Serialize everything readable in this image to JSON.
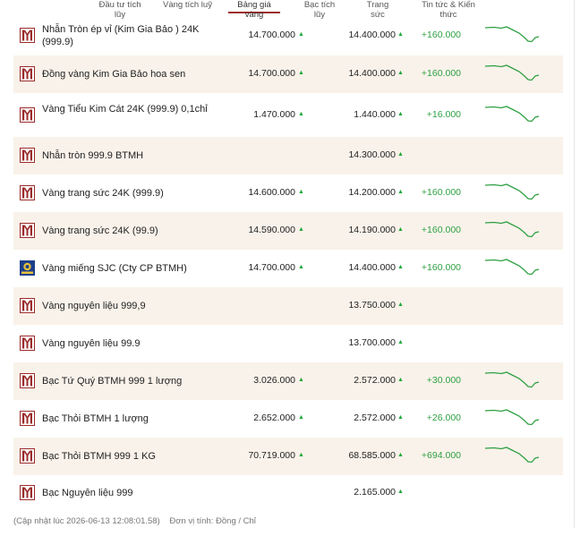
{
  "tabs": [
    {
      "label": "Đầu tư tích lũy",
      "active": false
    },
    {
      "label": "Vàng tích luỹ",
      "active": false
    },
    {
      "label": "Bảng giá vàng",
      "active": true
    },
    {
      "label": "Bạc tích lũy",
      "active": false
    },
    {
      "label": "Trang sức",
      "active": false
    },
    {
      "label": "Tin tức & Kiến thức",
      "active": false
    }
  ],
  "colors": {
    "brand": "#9b2b2b",
    "up": "#2ea043",
    "row_shade": "#f9f2ea"
  },
  "rows": [
    {
      "name": "Nhẫn Tròn ép vỉ (Kim Gia Bảo ) 24K (999.9)",
      "buy": "14.700.000",
      "sell": "14.400.000",
      "change": "+160.000",
      "logo": "btmh-logo",
      "trend": "down"
    },
    {
      "name": "Đồng vàng Kim Gia Bảo hoa sen",
      "buy": "14.700.000",
      "sell": "14.400.000",
      "change": "+160.000",
      "logo": "btmh-logo",
      "trend": "down"
    },
    {
      "name": "Vàng Tiểu Kim Cát 24K (999.9) 0,1chỉ",
      "buy": "1.470.000",
      "sell": "1.440.000",
      "change": "+16.000",
      "logo": "btmh-logo",
      "trend": "down"
    },
    {
      "name": "Nhẫn tròn 999.9 BTMH",
      "buy": "",
      "sell": "14.300.000",
      "change": "",
      "logo": "btmh-logo",
      "trend": ""
    },
    {
      "name": "Vàng trang sức 24K (999.9)",
      "buy": "14.600.000",
      "sell": "14.200.000",
      "change": "+160.000",
      "logo": "btmh-logo",
      "trend": "down"
    },
    {
      "name": "Vàng trang sức 24K (99.9)",
      "buy": "14.590.000",
      "sell": "14.190.000",
      "change": "+160.000",
      "logo": "btmh-logo",
      "trend": "down"
    },
    {
      "name": "Vàng miếng SJC (Cty CP BTMH)",
      "buy": "14.700.000",
      "sell": "14.400.000",
      "change": "+160.000",
      "logo": "sjc-logo",
      "trend": "down"
    },
    {
      "name": "Vàng nguyên liệu 999,9",
      "buy": "",
      "sell": "13.750.000",
      "change": "",
      "logo": "btmh-logo",
      "trend": ""
    },
    {
      "name": "Vàng nguyên liệu 99.9",
      "buy": "",
      "sell": "13.700.000",
      "change": "",
      "logo": "btmh-logo",
      "trend": ""
    },
    {
      "name": "Bạc Tứ Quý BTMH 999 1 lượng",
      "buy": "3.026.000",
      "sell": "2.572.000",
      "change": "+30.000",
      "logo": "btmh-logo",
      "trend": "down"
    },
    {
      "name": "Bạc Thỏi BTMH 1 lượng",
      "buy": "2.652.000",
      "sell": "2.572.000",
      "change": "+26.000",
      "logo": "btmh-logo",
      "trend": "down"
    },
    {
      "name": "Bạc Thỏi BTMH 999 1 KG",
      "buy": "70.719.000",
      "sell": "68.585.000",
      "change": "+694.000",
      "logo": "btmh-logo",
      "trend": "down"
    },
    {
      "name": "Bạc Nguyên liệu 999",
      "buy": "",
      "sell": "2.165.000",
      "change": "",
      "logo": "btmh-logo",
      "trend": ""
    }
  ],
  "footer": {
    "updated": "(Cập nhật lúc 2026-06-13 12:08:01.58)",
    "unit": "Đơn vị tính: Đồng / Chỉ"
  }
}
